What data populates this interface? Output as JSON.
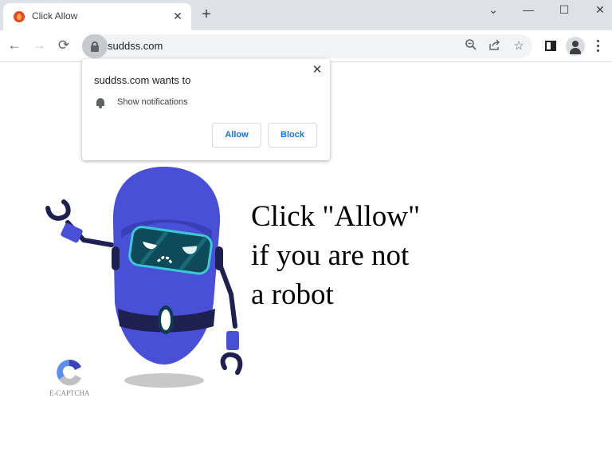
{
  "browser": {
    "tab": {
      "title": "Click Allow",
      "favicon": "fire-favicon-icon",
      "close_icon": "✕"
    },
    "new_tab_icon": "+",
    "window_controls": {
      "tab_search": "⌄",
      "minimize": "—",
      "maximize": "☐",
      "close": "✕"
    },
    "nav": {
      "back": "←",
      "forward": "→",
      "reload": "⟳"
    },
    "address": {
      "url": "suddss.com",
      "secure_icon": "lock-icon"
    },
    "omnibox_icons": {
      "zoom": "zoom-out-icon",
      "share": "share-icon",
      "bookmark": "☆"
    },
    "toolbar_icons": [
      "side-panel-icon",
      "profile-icon",
      "menu-icon"
    ]
  },
  "permission_popup": {
    "title": "suddss.com wants to",
    "permission": "Show notifications",
    "permission_icon": "bell-icon",
    "allow_label": "Allow",
    "block_label": "Block",
    "close_icon": "✕"
  },
  "page": {
    "headline_lines": [
      "Click \"Allow\"",
      "if you are not",
      "a robot"
    ],
    "captcha_label": "E-CAPTCHA",
    "colors": {
      "robot_body": "#4a4fd8",
      "robot_dark": "#1e2150",
      "visor": "#0d4a5a",
      "visor_rim": "#3cc9d6",
      "button_text": "#1a73e8"
    }
  }
}
